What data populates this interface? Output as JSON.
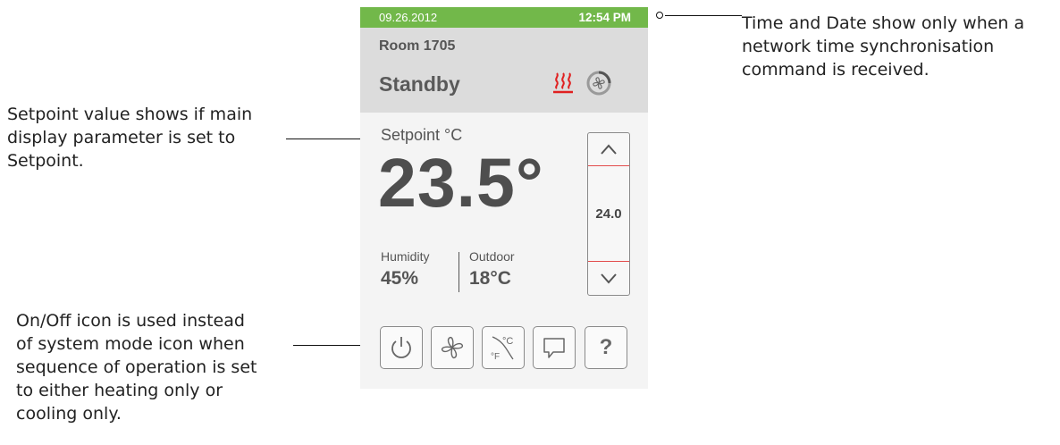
{
  "device": {
    "status_bar": {
      "date": "09.26.2012",
      "time": "12:54 PM",
      "color": "#72b84a"
    },
    "header": {
      "room": "Room 1705",
      "mode": "Standby"
    },
    "icons": {
      "heat": "heating-icon",
      "fan_status": "fan-status-icon",
      "accent_red": "#e02020"
    },
    "setpoint": {
      "label": "Setpoint °C",
      "value": "23.5°"
    },
    "humidity": {
      "label": "Humidity",
      "value": "45%"
    },
    "outdoor": {
      "label": "Outdoor",
      "value": "18°C"
    },
    "slider": {
      "value": "24.0",
      "up_icon": "chevron-up-icon",
      "down_icon": "chevron-down-icon"
    },
    "buttons": [
      {
        "name": "power",
        "icon": "power-icon"
      },
      {
        "name": "fan",
        "icon": "fan-icon"
      },
      {
        "name": "units",
        "icon": "units-celsius-fahrenheit-icon"
      },
      {
        "name": "message",
        "icon": "message-icon"
      },
      {
        "name": "help",
        "icon": "help-icon",
        "label": "?"
      }
    ]
  },
  "annotations": {
    "time_date": [
      "Time and Date show only when a",
      "network time synchronisation",
      "command is received."
    ],
    "setpoint": [
      "Setpoint value shows if main",
      "display parameter is set to",
      "Setpoint."
    ],
    "onoff": [
      "On/Off icon is used instead",
      "of system mode icon when",
      "sequence of operation is set",
      "to either heating only or",
      "cooling only."
    ]
  }
}
